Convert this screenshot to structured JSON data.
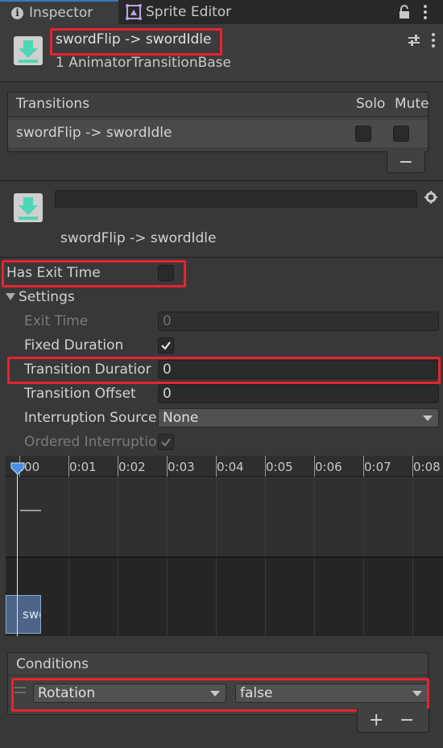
{
  "tabs": {
    "inspector": "Inspector",
    "sprite_editor": "Sprite Editor"
  },
  "header": {
    "title": "swordFlip -> swordIdle",
    "subtitle": "1 AnimatorTransitionBase"
  },
  "transitions_list": {
    "title": "Transitions",
    "solo_label": "Solo",
    "mute_label": "Mute",
    "rows": [
      {
        "name": "swordFlip -> swordIdle",
        "solo": false,
        "mute": false
      }
    ],
    "remove_label": "−"
  },
  "transition": {
    "name_value": "",
    "label": "swordFlip -> swordIdle"
  },
  "settings": {
    "has_exit_time_label": "Has Exit Time",
    "has_exit_time": false,
    "section_label": "Settings",
    "exit_time_label": "Exit Time",
    "exit_time_value": "0",
    "fixed_duration_label": "Fixed Duration",
    "fixed_duration": true,
    "transition_duration_label": "Transition Duratior",
    "transition_duration_value": "0",
    "transition_offset_label": "Transition Offset",
    "transition_offset_value": "0",
    "interruption_source_label": "Interruption Source",
    "interruption_source_value": "None",
    "ordered_interruption_label": "Ordered Interruptio",
    "ordered_interruption": true
  },
  "timeline": {
    "ticks": [
      ":00",
      "0:01",
      "0:02",
      "0:03",
      "0:04",
      "0:05",
      "0:06",
      "0:07",
      "0:08"
    ],
    "clip_label": "swo"
  },
  "conditions": {
    "title": "Conditions",
    "items": [
      {
        "parameter": "Rotation",
        "value": "false"
      }
    ],
    "add_label": "+",
    "remove_label": "−"
  },
  "colors": {
    "highlight": "#e8232d",
    "accent": "#3a79bb",
    "icon_green": "#4fd6b4"
  }
}
